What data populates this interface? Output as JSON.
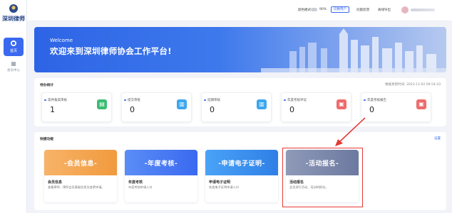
{
  "sidebar": {
    "logo_text": "深圳律师",
    "items": [
      {
        "label": "首页",
        "icon": "home-icon",
        "active": true
      },
      {
        "label": "会员中心",
        "icon": "grid-icon",
        "active": false
      }
    ]
  },
  "header": {
    "theme_label": "颜色模式",
    "zoom_text": "90%",
    "switch_btn": "切换用户",
    "help_text": "问题反馈",
    "export_text": "离线导出"
  },
  "banner": {
    "welcome": "Welcome",
    "title": "欢迎来到深圳律师协会工作平台!"
  },
  "todo": {
    "title": "待办统计",
    "updated": "数据更新时间: 2023-12-02 09:54:43",
    "stats": [
      {
        "label": "案件备案审核",
        "value": "1",
        "icon_color": "#3dbb74"
      },
      {
        "label": "提交审批",
        "value": "0",
        "icon_color": "#3aa7ef"
      },
      {
        "label": "延期审核",
        "value": "0",
        "icon_color": "#3aa7ef"
      },
      {
        "label": "年度考核评议",
        "value": "0",
        "icon_color": "#ef6a6a"
      },
      {
        "label": "年度考核报告",
        "value": "0",
        "icon_color": "#ef6a6a"
      }
    ]
  },
  "quick": {
    "title": "快捷功能",
    "settings": "设置",
    "items": [
      {
        "banner": "-会员信息-",
        "name": "会员信息",
        "desc": "查看律师、律所会员基础信息及变更申请。",
        "color_from": "#f7b368",
        "color_to": "#f19a3e"
      },
      {
        "banner": "-年度考核-",
        "name": "年度考核",
        "desc": "年度考核申请入口",
        "color_from": "#5b8df6",
        "color_to": "#3a69f0"
      },
      {
        "banner": "-申请电子证明-",
        "name": "申请电子证明",
        "desc": "各类电子证明申请入口",
        "color_from": "#4aa3f7",
        "color_to": "#2f7fe6"
      },
      {
        "banner": "-活动报名-",
        "name": "活动报名",
        "desc": "会员进行活动、培训的报名。",
        "color_from": "#8f9ab8",
        "color_to": "#6c79a0"
      }
    ]
  }
}
